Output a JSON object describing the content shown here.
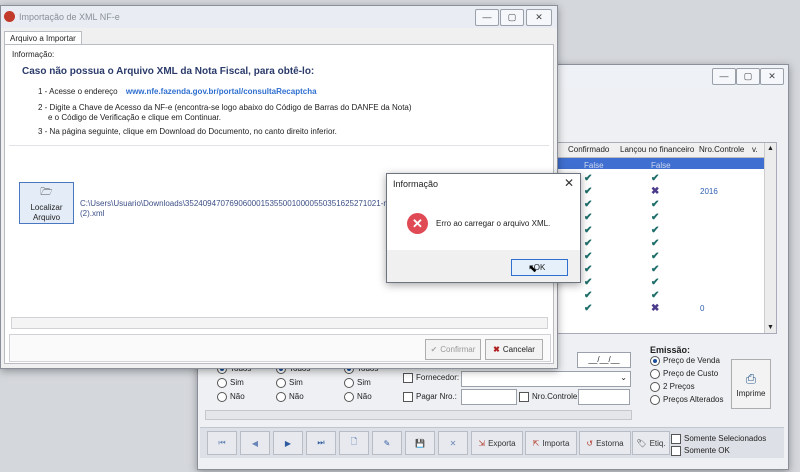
{
  "import_window": {
    "title": "Importação de XML NF-e",
    "tab_label": "Arquivo a Importar",
    "section_label": "Informação:",
    "heading": "Caso não possua o Arquivo XML da Nota Fiscal, para obtê-lo:",
    "step1_prefix": "1 - Acesse o endereço",
    "step1_link": "www.nfe.fazenda.gov.br/portal/consultaRecaptcha",
    "step2_line1": "2 - Digite a Chave de Acesso da NF-e (encontra-se logo abaixo do Código de Barras do DANFE da Nota)",
    "step2_line2": "e o Código de Verificação e clique em Continuar.",
    "step3": "3 - Na página seguinte, clique em Download do Documento, no canto direito inferior.",
    "locate_button_line1": "Localizar",
    "locate_button_line2": "Arquivo",
    "file_path_line1": "C:\\Users\\Usuario\\Downloads\\35240947076906000153550010000550351625271021-nfe",
    "file_path_line2": "(2).xml",
    "confirm_label": "Confirmar",
    "cancel_label": "Cancelar"
  },
  "dialog": {
    "title": "Informação",
    "message": "Erro ao carregar o arquivo XML.",
    "ok_label": "OK"
  },
  "grid": {
    "columns": [
      "Confirmado",
      "Lançou no financeiro",
      "Nro.Controle",
      "v."
    ],
    "rows": [
      {
        "confirmado": "False",
        "lancou": "False",
        "nro": ""
      },
      {
        "confirmado": "check",
        "lancou": "check",
        "nro": ""
      },
      {
        "confirmado": "check",
        "lancou": "x",
        "nro": "2016"
      },
      {
        "confirmado": "check",
        "lancou": "check",
        "nro": ""
      },
      {
        "confirmado": "check",
        "lancou": "check",
        "nro": ""
      },
      {
        "confirmado": "check",
        "lancou": "check",
        "nro": ""
      },
      {
        "confirmado": "check",
        "lancou": "check",
        "nro": ""
      },
      {
        "confirmado": "check",
        "lancou": "check",
        "nro": ""
      },
      {
        "confirmado": "check",
        "lancou": "check",
        "nro": ""
      },
      {
        "confirmado": "check",
        "lancou": "check",
        "nro": ""
      },
      {
        "confirmado": "check",
        "lancou": "check",
        "nro": ""
      },
      {
        "confirmado": "check",
        "lancou": "x",
        "nro": "0"
      }
    ]
  },
  "filters": {
    "col1": [
      "Todos",
      "Sim",
      "Não"
    ],
    "col2": [
      "Todos",
      "Sim",
      "Não"
    ],
    "col3": [
      "Todos",
      "Sim",
      "Não"
    ],
    "fornecedor_label": "Fornecedor:",
    "pagar_label": "Pagar Nro.:",
    "nro_controle_label": "Nro.Controle",
    "date_placeholder": "__/__/__"
  },
  "emissao": {
    "label": "Emissão:",
    "options": [
      "Preço de Venda",
      "Preço de Custo",
      "2 Preços",
      "Preços Alterados"
    ],
    "imprime_label": "Imprime"
  },
  "toolbar": {
    "exporta": "Exporta",
    "importa": "Importa",
    "estorna": "Estorna",
    "etiq": "Etiq.",
    "somente_selecionados": "Somente Selecionados",
    "somente_ok": "Somente OK"
  }
}
